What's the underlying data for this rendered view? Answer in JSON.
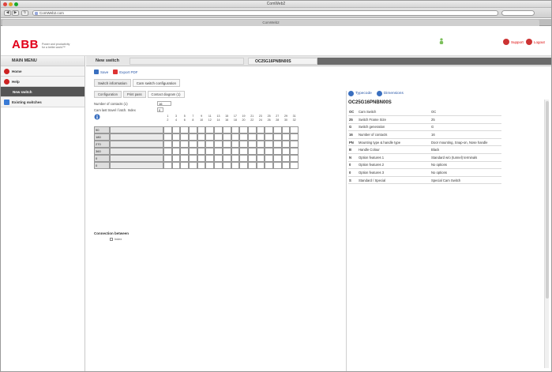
{
  "window": {
    "title": "ComWeb2",
    "tab_title": "ComWeb2"
  },
  "browser": {
    "url": "ComWeb2.com"
  },
  "header": {
    "logo": "ABB",
    "tagline_line1": "Power and productivity",
    "tagline_line2": "for a better world™",
    "links": [
      "Support",
      "Logout"
    ]
  },
  "sidebar": {
    "title": "MAIN MENU",
    "items": [
      {
        "label": "Home",
        "icon": "home-icon",
        "active": false
      },
      {
        "label": "Help",
        "icon": "help-icon",
        "active": false
      },
      {
        "label": "New switch",
        "icon": "",
        "active": true
      },
      {
        "label": "Existing switches",
        "icon": "folder-icon",
        "active": false
      }
    ]
  },
  "main": {
    "title": "New switch",
    "code": "OC25G16PNBN00S",
    "actions": [
      "Save",
      "Export PDF"
    ],
    "subtabs": [
      "Switch information",
      "Cam switch configuration"
    ],
    "inner_tabs": [
      "Configuration",
      "Print pass",
      "Contact diagram (1)"
    ],
    "fields": {
      "contacts_label": "Number of contacts (1)",
      "contacts_value": "16",
      "latching_label": "Cam last travel / latch. Index",
      "latching_value": "0"
    },
    "grid": {
      "row_labels": [
        "90",
        "180",
        "270",
        "360",
        "0",
        "0"
      ],
      "col_header_top": [
        "1",
        "3",
        "5",
        "7",
        "9",
        "11",
        "13",
        "15",
        "17",
        "19",
        "21",
        "23",
        "25",
        "27",
        "29",
        "31"
      ],
      "col_header_bottom": [
        "2",
        "4",
        "6",
        "8",
        "10",
        "12",
        "14",
        "16",
        "18",
        "20",
        "22",
        "24",
        "26",
        "28",
        "30",
        "32"
      ]
    },
    "connection_label": "Connection between",
    "connection_option": "Index"
  },
  "typecode": {
    "tabs": [
      "Typecode",
      "Dimensions"
    ],
    "code": "OC25G16PNBN00S",
    "rows": [
      {
        "code": "OC",
        "desc": "Cam Switch",
        "value": "OC"
      },
      {
        "code": "25",
        "desc": "Switch Frame Size",
        "value": "25"
      },
      {
        "code": "G",
        "desc": "Switch generation",
        "value": "G"
      },
      {
        "code": "16",
        "desc": "Number of contacts",
        "value": "16"
      },
      {
        "code": "PN",
        "desc": "Mounting type & handle type",
        "value": "Door mounting, Snap-on, Nose handle"
      },
      {
        "code": "B",
        "desc": "Handle Colour",
        "value": "Black"
      },
      {
        "code": "N",
        "desc": "Option features 1",
        "value": "Standard w/o (tunnel) terminals"
      },
      {
        "code": "0",
        "desc": "Option features 2",
        "value": "No options"
      },
      {
        "code": "0",
        "desc": "Option features 3",
        "value": "No options"
      },
      {
        "code": "S",
        "desc": "Standard / Special",
        "value": "Special Cam Switch"
      }
    ]
  },
  "colors": {
    "brand": "#e2001a",
    "active_sidebar": "#555555",
    "link": "#2a58a8"
  }
}
